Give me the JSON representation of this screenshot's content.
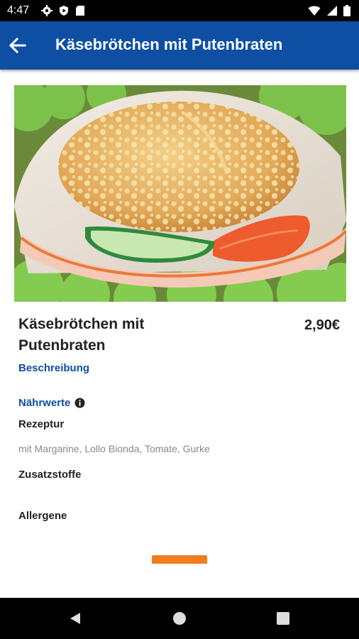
{
  "status_bar": {
    "time": "4:47",
    "icons_left": [
      "gear-icon",
      "play-protect-icon",
      "sd-card-icon"
    ],
    "icons_right": [
      "wifi-icon",
      "signal-icon",
      "battery-icon"
    ]
  },
  "app_bar": {
    "title": "Käsebrötchen mit Putenbraten",
    "back_icon": "arrow-left-icon"
  },
  "product": {
    "name": "Käsebrötchen mit Putenbraten",
    "price": "2,90€",
    "description_link": "Beschreibung",
    "nutrition_link": "Nährwerte",
    "recipe_label": "Rezeptur",
    "recipe_text": "mit Margarine, Lollo Bionda, Tomate, Gurke",
    "additives_label": "Zusatzstoffe",
    "allergens_label": "Allergene"
  },
  "colors": {
    "primary": "#0e4fa3",
    "accent": "#f07d1e"
  },
  "nav_bar": {
    "icons": [
      "back-icon",
      "home-icon",
      "recents-icon"
    ]
  }
}
